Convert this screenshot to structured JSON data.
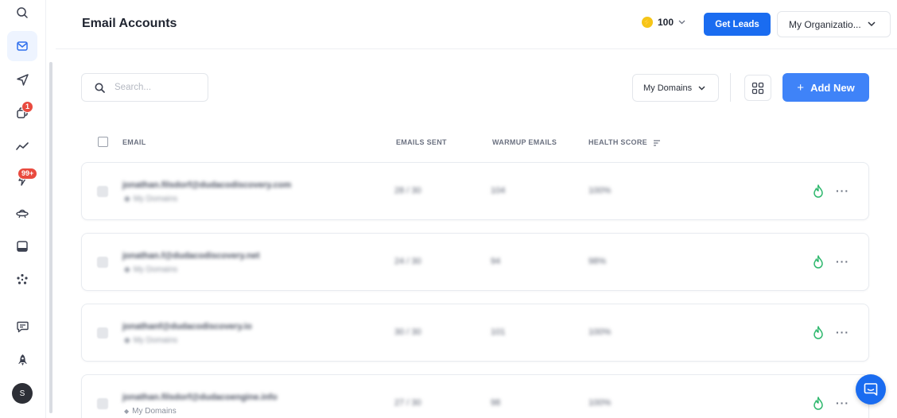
{
  "sidebar": {
    "items": [
      {
        "name": "search-icon",
        "active": false
      },
      {
        "name": "mail-icon",
        "active": true
      },
      {
        "name": "send-icon",
        "active": false
      },
      {
        "name": "copy-icon",
        "active": false,
        "badge": "1"
      },
      {
        "name": "analytics-icon",
        "active": false
      },
      {
        "name": "lightning-icon",
        "active": false,
        "badge": "99+"
      },
      {
        "name": "ufo-icon",
        "active": false
      },
      {
        "name": "inbox-icon",
        "active": false
      },
      {
        "name": "dots-cluster-icon",
        "active": false
      },
      {
        "name": "chat-edit-icon",
        "active": false
      },
      {
        "name": "rocket-icon",
        "active": false
      }
    ],
    "avatar": "S"
  },
  "header": {
    "title": "Email Accounts",
    "credits": "100",
    "get_leads": "Get Leads",
    "organization": "My Organizatio..."
  },
  "toolbar": {
    "search_placeholder": "Search...",
    "domain_filter": "My Domains",
    "add_new": "Add New"
  },
  "table": {
    "columns": {
      "email": "EMAIL",
      "emails_sent": "EMAILS SENT",
      "warmup_emails": "WARMUP EMAILS",
      "health_score": "HEALTH SCORE"
    },
    "rows": [
      {
        "email": "jonathan.filsdorf@dudacodiscovery.com",
        "domain": "My Domains",
        "sent": "28 / 30",
        "warmup": "104",
        "health": "100%"
      },
      {
        "email": "jonathan.f@dudacodiscovery.net",
        "domain": "My Domains",
        "sent": "24 / 30",
        "warmup": "94",
        "health": "98%"
      },
      {
        "email": "jonathanf@dudacodiscovery.io",
        "domain": "My Domains",
        "sent": "30 / 30",
        "warmup": "101",
        "health": "100%"
      },
      {
        "email": "jonathan.filsdorf@dudacoengine.info",
        "domain": "My Domains",
        "sent": "27 / 30",
        "warmup": "98",
        "health": "100%"
      }
    ]
  },
  "colors": {
    "primary": "#1a6cf0",
    "add_button": "#3f83f8",
    "healthy": "#2fb86e",
    "badge": "#e94a3f"
  }
}
